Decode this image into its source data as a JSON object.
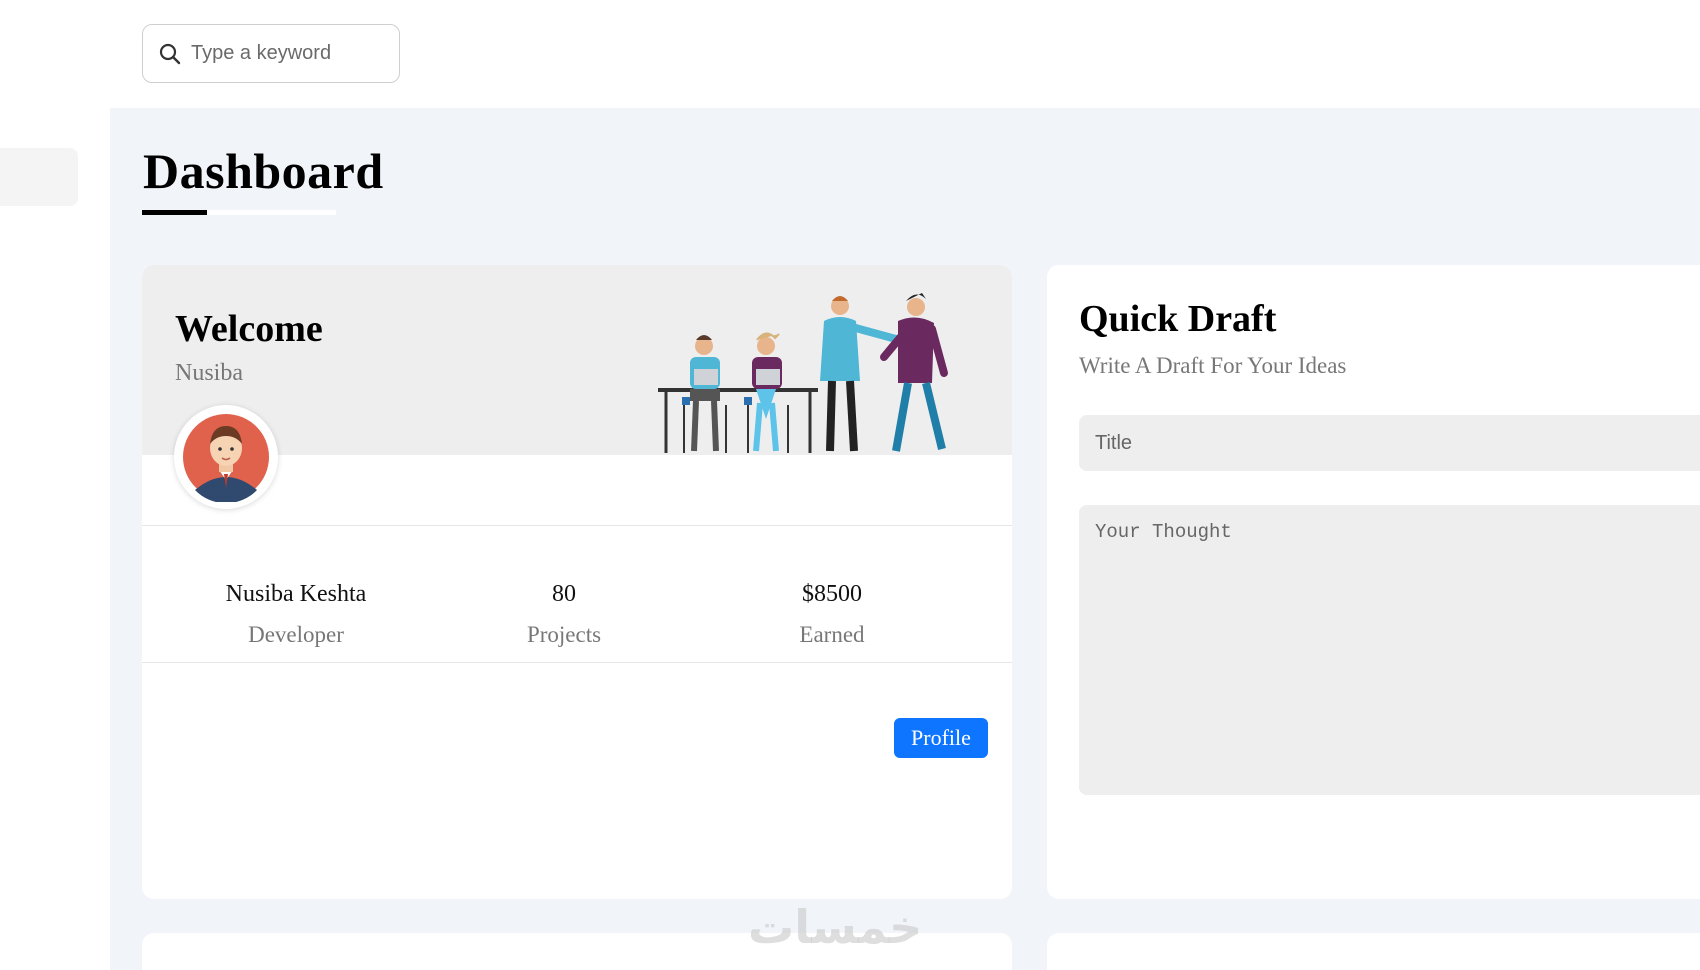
{
  "search": {
    "placeholder": "Type a keyword"
  },
  "page": {
    "title": "Dashboard"
  },
  "welcome": {
    "title": "Welcome",
    "user_first_name": "Nusiba",
    "stats": [
      {
        "value": "Nusiba Keshta",
        "label": "Developer"
      },
      {
        "value": "80",
        "label": "Projects"
      },
      {
        "value": "$8500",
        "label": "Earned"
      }
    ],
    "profile_button": "Profile"
  },
  "quick_draft": {
    "title": "Quick Draft",
    "subtitle": "Write A Draft For Your Ideas",
    "title_placeholder": "Title",
    "thought_placeholder": "Your Thought"
  },
  "watermark": "خمسات",
  "colors": {
    "accent": "#0d75ff",
    "main_bg": "#f1f4f9",
    "card_header_bg": "#eeeeee"
  }
}
